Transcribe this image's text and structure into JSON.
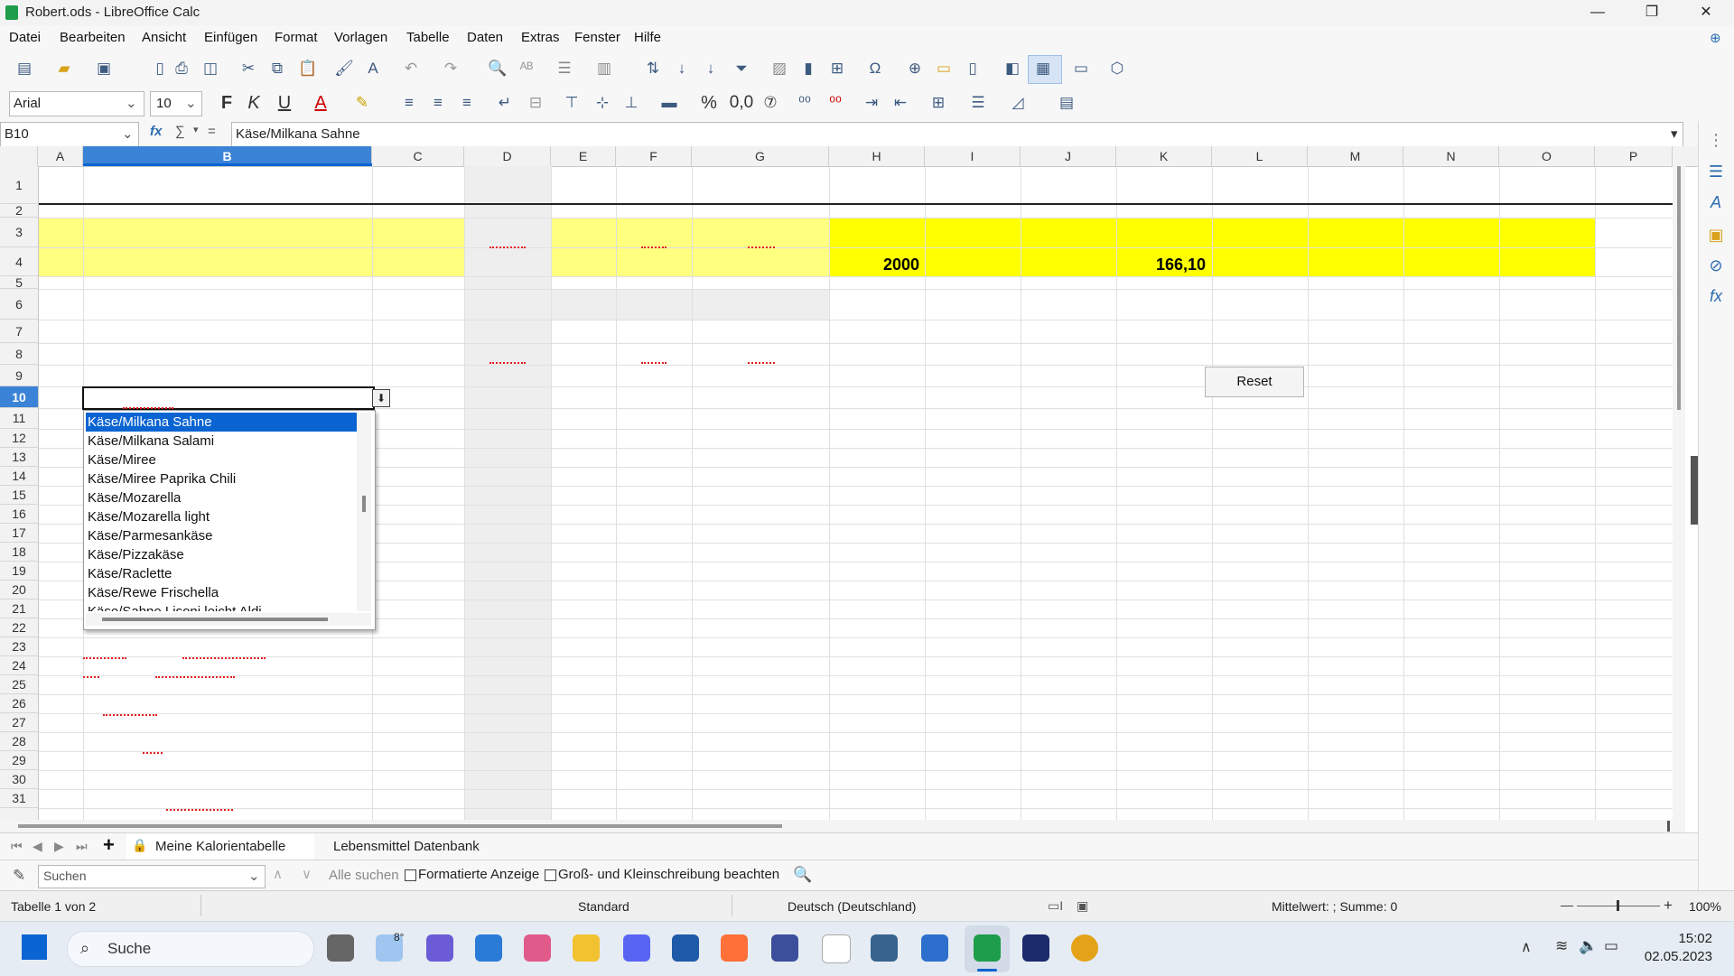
{
  "window": {
    "title": "Robert.ods - LibreOffice Calc",
    "controls": {
      "minimize": "—",
      "maximize": "❐",
      "close": "✕"
    }
  },
  "menu": [
    "Datei",
    "Bearbeiten",
    "Ansicht",
    "Einfügen",
    "Format",
    "Vorlagen",
    "Tabelle",
    "Daten",
    "Extras",
    "Fenster",
    "Hilfe"
  ],
  "toolbar2": {
    "font_name": "Arial",
    "font_size": "10",
    "bold": "F",
    "italic": "K",
    "underline": "U",
    "percent": "%",
    "decimal": "0,0"
  },
  "formula_bar": {
    "cell_ref": "B10",
    "content": "Käse/Milkana Sahne",
    "fx": "fx",
    "sum": "∑",
    "equals": "="
  },
  "columns": [
    "A",
    "B",
    "C",
    "D",
    "E",
    "F",
    "G",
    "H",
    "I",
    "J",
    "K",
    "L",
    "M",
    "N",
    "O",
    "P"
  ],
  "selected_column": "B",
  "rows": [
    "1",
    "2",
    "3",
    "4",
    "5",
    "6",
    "7",
    "8",
    "9",
    "10",
    "11",
    "12",
    "13",
    "14",
    "15",
    "16",
    "17",
    "18",
    "19",
    "20",
    "21",
    "22",
    "23",
    "24",
    "25",
    "26",
    "27",
    "28",
    "29",
    "30",
    "31"
  ],
  "selected_row": "10",
  "cells": {
    "H4": "2000",
    "K4": "166,10"
  },
  "reset_button": "Reset",
  "dropdown": {
    "items": [
      "Käse/Milkana Sahne",
      "Käse/Milkana Salami",
      "Käse/Miree",
      "Käse/Miree Paprika Chili",
      "Käse/Mozarella",
      "Käse/Mozarella light",
      "Käse/Parmesankäse",
      "Käse/Pizzakäse",
      "Käse/Raclette",
      "Käse/Rewe Frischella",
      "Käse/Sahne Lisoni leicht Aldi"
    ],
    "selected": 0
  },
  "sheet_tabs": [
    "Meine Kalorientabelle",
    "Lebensmittel Datenbank"
  ],
  "active_sheet": 0,
  "find_bar": {
    "placeholder": "Suchen",
    "find_all": "Alle suchen",
    "formatted": "Formatierte Anzeige",
    "match_case": "Groß- und Kleinschreibung beachten"
  },
  "status_bar": {
    "sheet_info": "Tabelle 1 von 2",
    "style": "Standard",
    "language": "Deutsch (Deutschland)",
    "summary": "Mittelwert: ; Summe: 0",
    "zoom": "100%",
    "zoom_minus": "—",
    "zoom_plus": "+"
  },
  "taskbar": {
    "search_label": "Suche",
    "weather": "8°",
    "time": "15:02",
    "date": "02.05.2023"
  },
  "colors": {
    "yellow_light": "#ffff80",
    "yellow": "#ffff00",
    "selection": "#0a64d2",
    "header_selected": "#3b83d6"
  }
}
